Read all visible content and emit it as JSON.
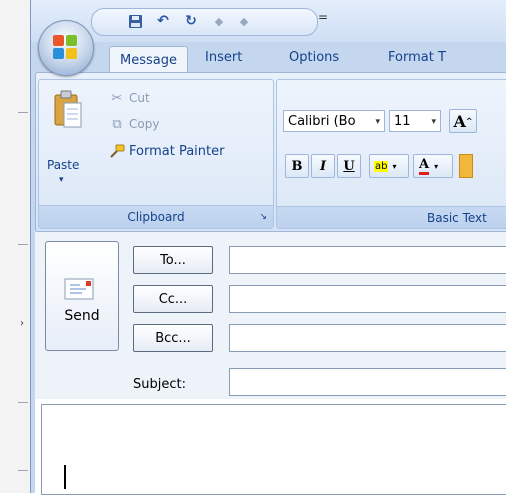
{
  "quick_access": {
    "icons": [
      "save-icon",
      "undo-icon",
      "redo-icon",
      "up-arrow-icon",
      "down-arrow-icon"
    ],
    "customize_glyph": "="
  },
  "tabs": [
    {
      "label": "Message",
      "active": true
    },
    {
      "label": "Insert",
      "active": false
    },
    {
      "label": "Options",
      "active": false
    },
    {
      "label": "Format T",
      "active": false
    }
  ],
  "clipboard": {
    "paste_label": "Paste",
    "cut_label": "Cut",
    "copy_label": "Copy",
    "format_painter_label": "Format Painter",
    "group_label": "Clipboard"
  },
  "basic_text": {
    "font_name": "Calibri (Bo",
    "font_size": "11",
    "grow_font_glyph": "A",
    "bold_glyph": "B",
    "italic_glyph": "I",
    "underline_glyph": "U",
    "highlight_glyph": "ab",
    "font_color_glyph": "A",
    "group_label": "Basic Text"
  },
  "compose": {
    "send_label": "Send",
    "to_label": "To...",
    "cc_label": "Cc...",
    "bcc_label": "Bcc...",
    "subject_label": "Subject:",
    "to_value": "",
    "cc_value": "",
    "bcc_value": "",
    "subject_value": ""
  },
  "colors": {
    "ribbon_blue": "#d6e4f6",
    "label_blue": "#15428b",
    "highlight_yellow": "#ffff00",
    "font_color_red": "#e02020"
  }
}
